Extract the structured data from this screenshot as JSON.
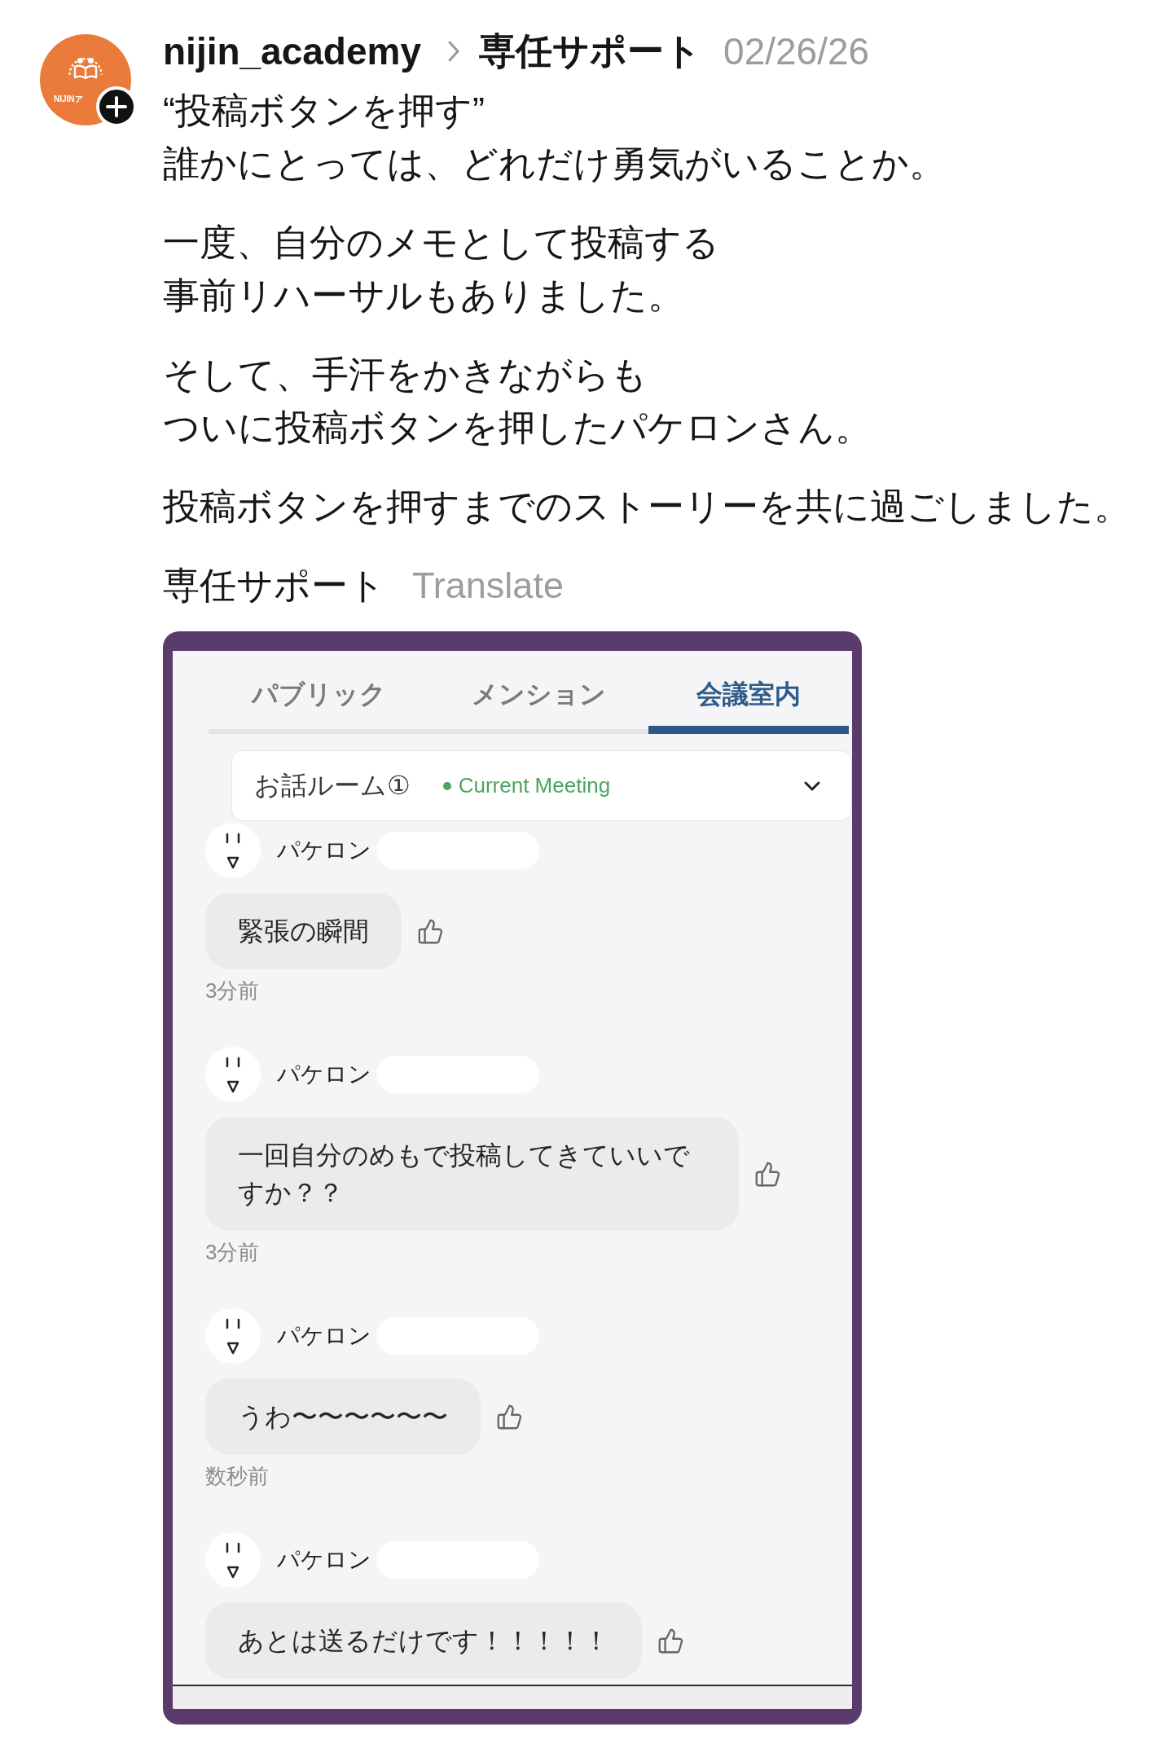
{
  "post": {
    "author": {
      "name": "nijin_academy",
      "avatar_text": "NIJINア"
    },
    "channel": "専任サポート",
    "date": "02/26/26",
    "paragraphs": [
      [
        "“投稿ボタンを押す”",
        "誰かにとっては、どれだけ勇気がいることか。"
      ],
      [
        "一度、自分のメモとして投稿する",
        "事前リハーサルもありました。"
      ],
      [
        "そして、手汗をかきながらも",
        "ついに投稿ボタンを押したパケロンさん。"
      ],
      [
        "投稿ボタンを押すまでのストーリーを共に過ごしました。"
      ]
    ],
    "tag": "専任サポート",
    "translate_link": "Translate",
    "attached_screenshot": {
      "tabs": [
        {
          "label": "パブリック",
          "selected": false
        },
        {
          "label": "メンション",
          "selected": false
        },
        {
          "label": "会議室内",
          "selected": true
        }
      ],
      "room_select": {
        "value": "お話ルーム①",
        "status": "Current Meeting"
      },
      "messages": [
        {
          "author": "パケロン",
          "text": "緊張の瞬間",
          "time": "3分前"
        },
        {
          "author": "パケロン",
          "text": "一回自分のめもで投稿してきていいですか？？",
          "time": "3分前"
        },
        {
          "author": "パケロン",
          "text": "うわ〜〜〜〜〜〜",
          "time": "数秒前"
        },
        {
          "author": "パケロン",
          "text": "あとは送るだけです！！！！！"
        }
      ]
    }
  }
}
